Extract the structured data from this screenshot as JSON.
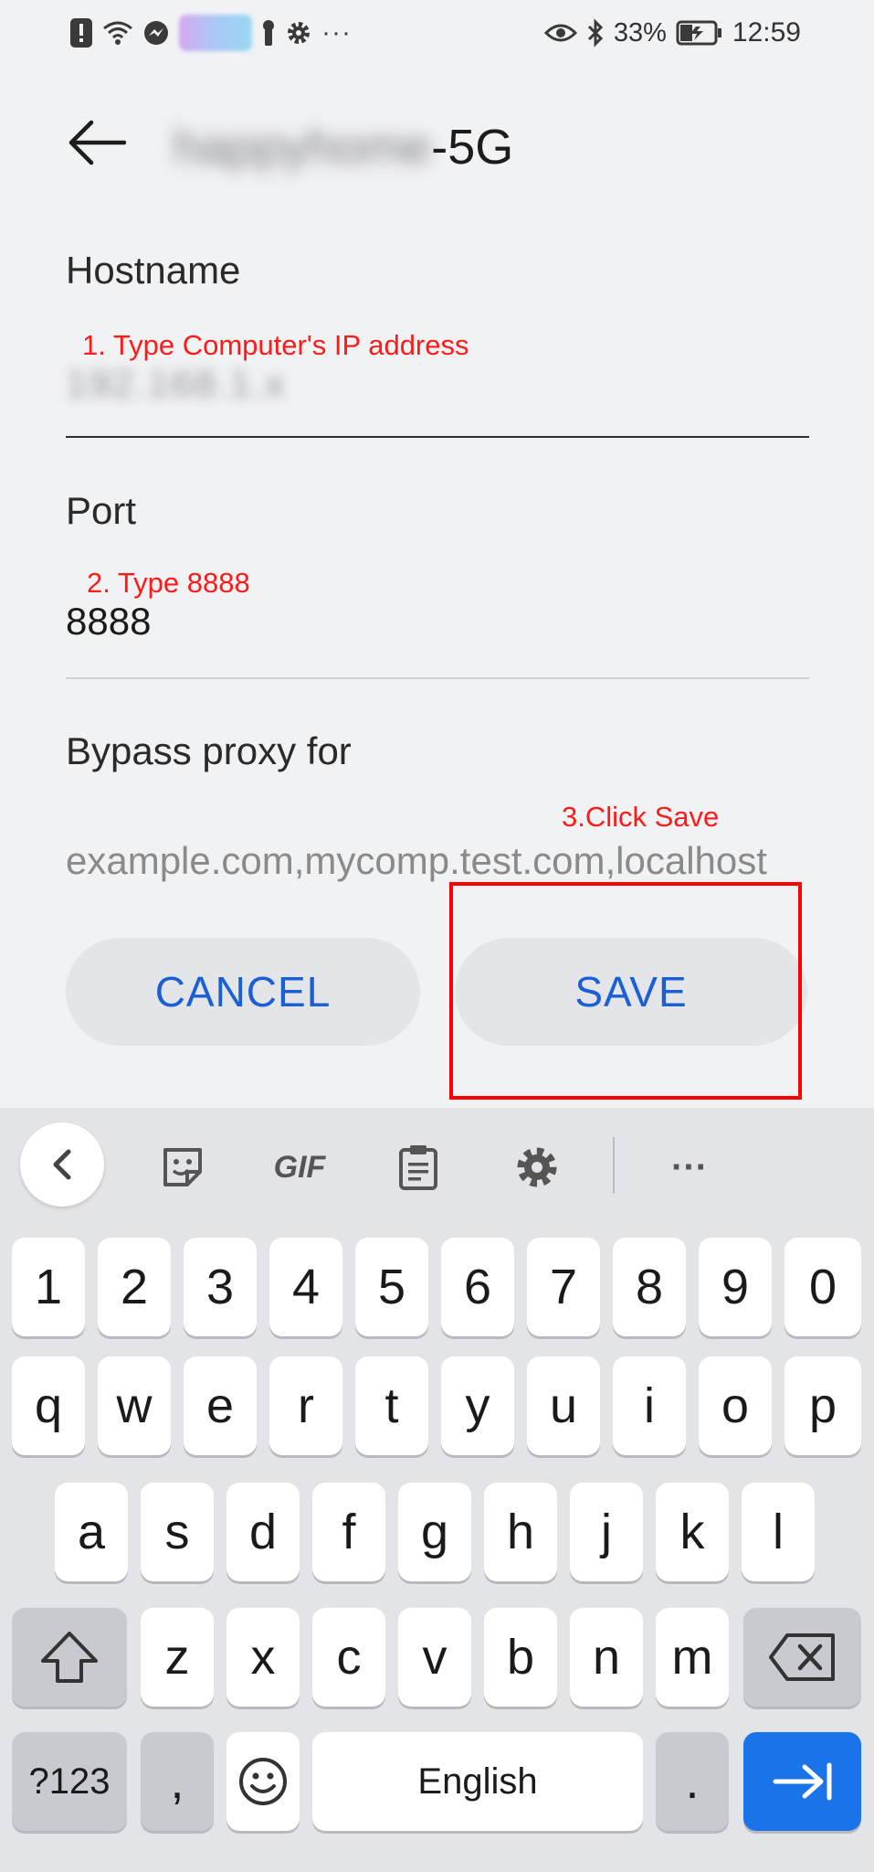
{
  "status_bar": {
    "battery": "33%",
    "time": "12:59",
    "overflow": "···"
  },
  "header": {
    "title_hidden": "happyhome",
    "title_suffix": "-5G"
  },
  "form": {
    "hostname": {
      "label": "Hostname",
      "value_hidden": "192.168.1.x",
      "annotation": "1. Type Computer's IP address"
    },
    "port": {
      "label": "Port",
      "value": "8888",
      "annotation": "2. Type 8888"
    },
    "bypass": {
      "label": "Bypass proxy for",
      "placeholder": "example.com,mycomp.test.com,localhost",
      "annotation": "3.Click Save"
    }
  },
  "buttons": {
    "cancel": "CANCEL",
    "save": "SAVE"
  },
  "keyboard": {
    "toolbar": {
      "gif_label": "GIF",
      "more_label": "···"
    },
    "number_row": [
      "1",
      "2",
      "3",
      "4",
      "5",
      "6",
      "7",
      "8",
      "9",
      "0"
    ],
    "row1": [
      "q",
      "w",
      "e",
      "r",
      "t",
      "y",
      "u",
      "i",
      "o",
      "p"
    ],
    "row2": [
      "a",
      "s",
      "d",
      "f",
      "g",
      "h",
      "j",
      "k",
      "l"
    ],
    "row3": [
      "z",
      "x",
      "c",
      "v",
      "b",
      "n",
      "m"
    ],
    "symbols_key": "?123",
    "comma_key": ",",
    "space_label": "English",
    "period_key": "."
  },
  "colors": {
    "accent": "#1a5fd6",
    "annotation": "#ff1a1a",
    "enter_key": "#1a73e8"
  }
}
